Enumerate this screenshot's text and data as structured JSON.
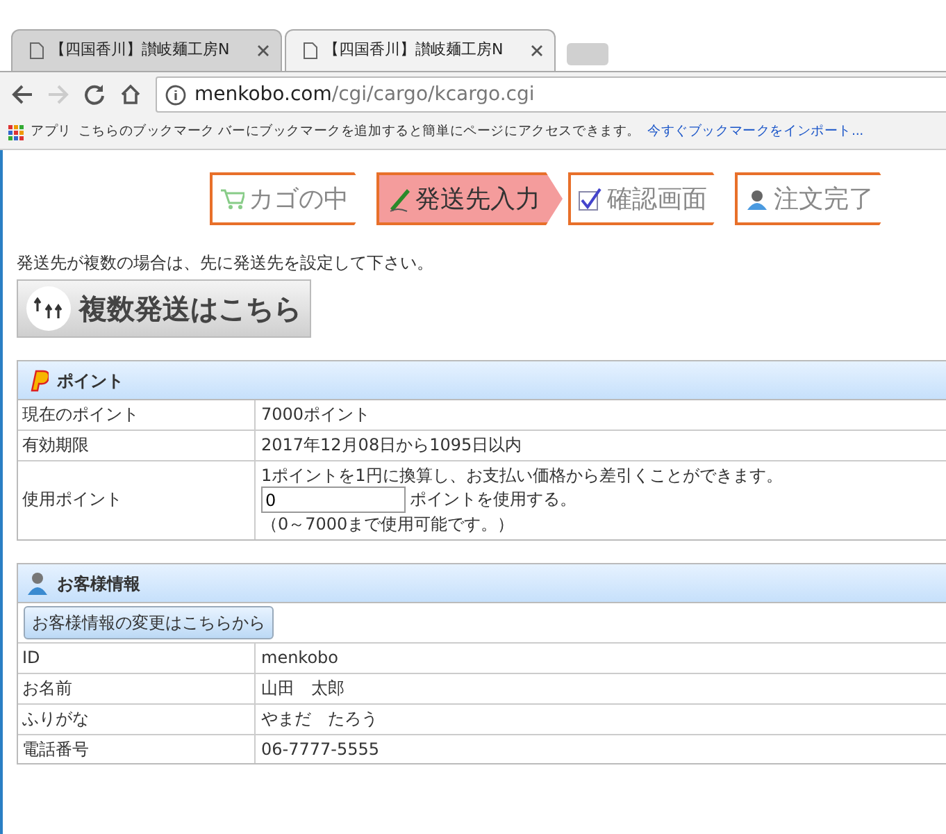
{
  "browser": {
    "tabs": [
      {
        "title": "【四国香川】讃岐麺工房N",
        "selected": false
      },
      {
        "title": "【四国香川】讃岐麺工房N",
        "selected": true
      }
    ],
    "address": {
      "host": "menkobo.com",
      "path": "/cgi/cargo/kcargo.cgi"
    },
    "bookmarks_bar": {
      "apps": "アプリ",
      "message": "こちらのブックマーク バーにブックマークを追加すると簡単にページにアクセスできます。",
      "import_link": "今すぐブックマークをインポート..."
    }
  },
  "steps": [
    {
      "kind": "cart",
      "label": "カゴの中",
      "selected": false
    },
    {
      "kind": "pen",
      "label": "発送先入力",
      "selected": true
    },
    {
      "kind": "check",
      "label": "確認画面",
      "selected": false
    },
    {
      "kind": "person",
      "label": "注文完了",
      "selected": false
    }
  ],
  "note": "発送先が複数の場合は、先に発送先を設定して下さい。",
  "multi_button": "複数発送はこちら",
  "points": {
    "title": "ポイント",
    "rows": [
      {
        "kind": "text",
        "label": "現在のポイント",
        "value": "7000ポイント"
      },
      {
        "kind": "text",
        "label": "有効期限",
        "value": "2017年12月08日から1095日以内"
      },
      {
        "kind": "input",
        "label": "使用ポイント",
        "intro": "1ポイントを1円に換算し、お支払い価格から差引くことができます。",
        "value": "0",
        "suffix": "ポイントを使用する。",
        "hint": "（0～7000まで使用可能です。）"
      }
    ]
  },
  "customer": {
    "title": "お客様情報",
    "button": "お客様情報の変更はこちらから",
    "rows": [
      {
        "kind": "text",
        "label": "ID",
        "value": "menkobo"
      },
      {
        "kind": "text",
        "label": "お名前",
        "value": "山田　太郎"
      },
      {
        "kind": "text",
        "label": "ふりがな",
        "value": "やまだ　たろう"
      },
      {
        "kind": "text",
        "label": "電話番号",
        "value": "06-7777-5555"
      }
    ]
  }
}
